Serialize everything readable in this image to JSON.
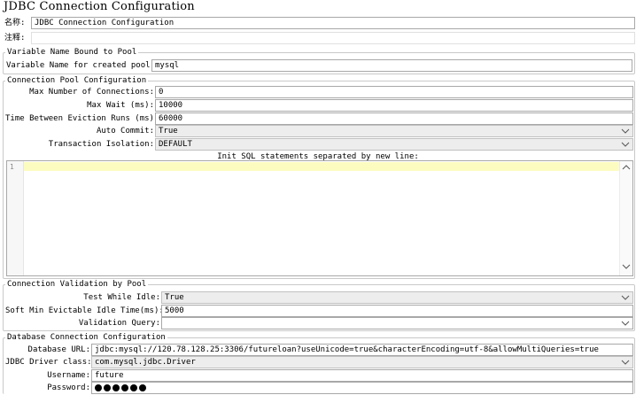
{
  "window": {
    "title": "JDBC Connection Configuration"
  },
  "general": {
    "name_label": "名称:",
    "name_value": "JDBC Connection Configuration",
    "comment_label": "注释:",
    "comment_value": ""
  },
  "variable_section": {
    "legend": "Variable Name Bound to Pool",
    "var_label": "Variable Name for created pool:",
    "var_value": "mysql"
  },
  "pool_section": {
    "legend": "Connection Pool Configuration",
    "max_connections_label": "Max Number of Connections:",
    "max_connections_value": "0",
    "max_wait_label": "Max Wait (ms):",
    "max_wait_value": "10000",
    "eviction_label": "Time Between Eviction Runs (ms):",
    "eviction_value": "60000",
    "auto_commit_label": "Auto Commit:",
    "auto_commit_value": "True",
    "isolation_label": "Transaction Isolation:",
    "isolation_value": "DEFAULT",
    "init_sql_label": "Init SQL statements separated by new line:",
    "init_sql_line_number": "1",
    "init_sql_value": ""
  },
  "validation_section": {
    "legend": "Connection Validation by Pool",
    "test_idle_label": "Test While Idle:",
    "test_idle_value": "True",
    "soft_min_label": "Soft Min Evictable Idle Time(ms):",
    "soft_min_value": "5000",
    "validation_query_label": "Validation Query:",
    "validation_query_value": ""
  },
  "database_section": {
    "legend": "Database Connection Configuration",
    "url_label": "Database URL:",
    "url_value": "jdbc:mysql://120.78.128.25:3306/futureloan?useUnicode=true&characterEncoding=utf-8&allowMultiQueries=true",
    "driver_label": "JDBC Driver class:",
    "driver_value": "com.mysql.jdbc.Driver",
    "username_label": "Username:",
    "username_value": "future",
    "password_label": "Password:",
    "password_length": 6
  },
  "icons": {
    "dropdown": "chevron-down-icon",
    "scroll_up": "chevron-up-icon",
    "scroll_down": "chevron-down-icon"
  }
}
